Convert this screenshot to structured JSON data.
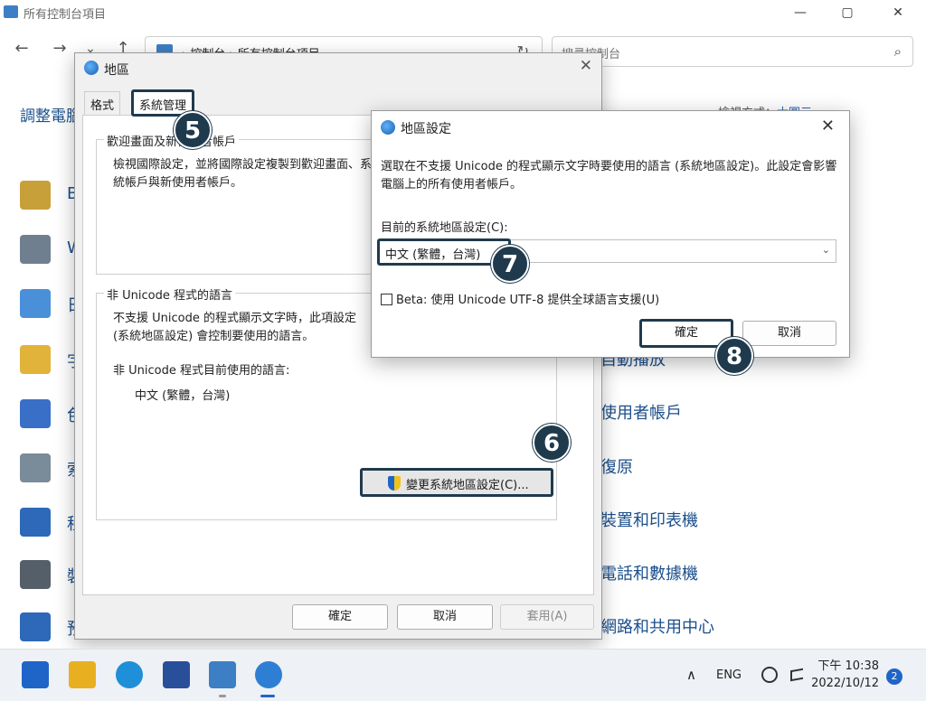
{
  "control_panel": {
    "window_title": "所有控制台項目",
    "minimize_glyph": "—",
    "maximize_glyph": "▢",
    "close_glyph": "✕",
    "back_glyph": "←",
    "forward_glyph": "→",
    "recent_glyph": "⌄",
    "up_glyph": "↑",
    "breadcrumb": "› 控制台 › 所有控制台項目",
    "refresh_glyph": "↻",
    "search_placeholder": "搜尋控制台",
    "search_glyph": "⌕",
    "heading": "調整電腦",
    "view_by_label": "檢視方式：",
    "view_by_value": "大圖示",
    "left_items": [
      {
        "label": "B",
        "icon": "bitlocker-icon",
        "color": "#c7a03a"
      },
      {
        "label": "W",
        "icon": "windows-tools-icon",
        "color": "#6f7f8f"
      },
      {
        "label": "日",
        "icon": "date-time-icon",
        "color": "#4a90d9"
      },
      {
        "label": "字",
        "icon": "fonts-icon",
        "color": "#e2b33a"
      },
      {
        "label": "色",
        "icon": "color-management-icon",
        "color": "#3a6fc7"
      },
      {
        "label": "索",
        "icon": "indexing-options-icon",
        "color": "#7a8b99"
      },
      {
        "label": "程",
        "icon": "programs-icon",
        "color": "#2e68b8"
      },
      {
        "label": "裝",
        "icon": "device-manager-icon",
        "color": "#555f6a"
      },
      {
        "label": "預",
        "icon": "default-programs-icon",
        "color": "#2e68b8"
      }
    ],
    "right_items": [
      "自動播放",
      "使用者帳戶",
      "復原",
      "裝置和印表機",
      "電話和數據機",
      "網路和共用中心"
    ]
  },
  "region_dialog": {
    "title": "地區",
    "close_glyph": "✕",
    "tabs": {
      "format": "格式",
      "admin": "系統管理"
    },
    "welcome_group": {
      "legend": "歡迎畫面及新使用者帳戶",
      "text": "檢視國際設定，並將國際設定複製到歡迎畫面、系統帳戶與新使用者帳戶。"
    },
    "nonunicode_group": {
      "legend": "非 Unicode 程式的語言",
      "text": "不支援 Unicode 的程式顯示文字時，此項設定 (系統地區設定) 會控制要使用的語言。",
      "current_label": "非 Unicode 程式目前使用的語言:",
      "current_value": "中文 (繁體，台灣)",
      "change_button": "變更系統地區設定(C)..."
    },
    "ok": "確定",
    "cancel": "取消",
    "apply": "套用(A)"
  },
  "region_settings_dialog": {
    "title": "地區設定",
    "close_glyph": "✕",
    "description": "選取在不支援 Unicode 的程式顯示文字時要使用的語言 (系統地區設定)。此設定會影響電腦上的所有使用者帳戶。",
    "current_label": "目前的系統地區設定(C):",
    "current_value": "中文 (繁體，台灣)",
    "chevron_glyph": "⌄",
    "beta_label": "Beta: 使用 Unicode UTF-8 提供全球語言支援(U)",
    "beta_checked": false,
    "ok": "確定",
    "cancel": "取消"
  },
  "badges": {
    "step5": "5",
    "step6": "6",
    "step7": "7",
    "step8": "8"
  },
  "taskbar": {
    "apps": [
      {
        "name": "start-icon",
        "color": "#1f65c8"
      },
      {
        "name": "file-explorer-icon",
        "color": "#e8b021"
      },
      {
        "name": "edge-icon",
        "color": "#1e8fd8"
      },
      {
        "name": "store-icon",
        "color": "#2a4f9a"
      },
      {
        "name": "control-panel-icon",
        "color": "#3d7fc4"
      },
      {
        "name": "region-globe-icon",
        "color": "#2e7fd4"
      }
    ],
    "tray": {
      "chevron": "∧",
      "language": "ENG",
      "time": "下午 10:38",
      "date": "2022/10/12",
      "notification_count": "2"
    }
  }
}
